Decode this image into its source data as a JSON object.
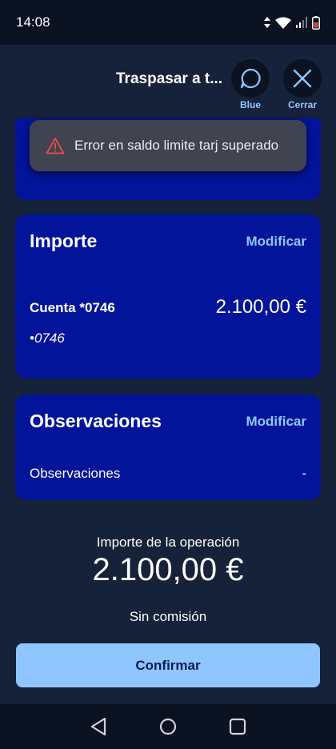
{
  "status_bar": {
    "time": "14:08"
  },
  "header": {
    "title": "Traspasar a t...",
    "blue_label": "Blue",
    "close_label": "Cerrar"
  },
  "toast": {
    "message": "Error en saldo limite tarj superado"
  },
  "importe_card": {
    "title": "Importe",
    "modify_label": "Modificar",
    "account_label": "Cuenta *0746",
    "account_sub": "•0746",
    "amount": "2.100,00 €"
  },
  "observaciones_card": {
    "title": "Observaciones",
    "modify_label": "Modificar",
    "field_label": "Observaciones",
    "field_value": "-"
  },
  "summary": {
    "label": "Importe de la operación",
    "amount": "2.100,00 €",
    "fee": "Sin comisión"
  },
  "confirm_button": {
    "label": "Confirmar"
  },
  "colors": {
    "background": "#16213a",
    "card": "#02149a",
    "accent": "#8fc6ff",
    "toast": "#3f4450",
    "warning": "#e04a4a"
  }
}
